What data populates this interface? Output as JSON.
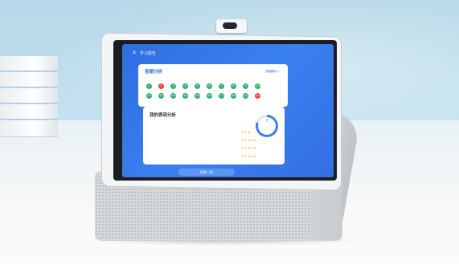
{
  "scene": {
    "accent_blue": "#3a7ff0",
    "wall_color": "#c4e2ef",
    "device_color": "#f4f5f6"
  },
  "screen": {
    "nav_title": "学习报告",
    "card1": {
      "title": "答题分析",
      "link": "查看解析 >",
      "legend": "",
      "answer_statuses": [
        "correct",
        "wrong",
        "correct",
        "correct",
        "correct",
        "correct",
        "correct",
        "correct",
        "correct",
        "correct",
        "correct",
        "correct",
        "correct",
        "correct",
        "correct",
        "correct",
        "correct",
        "correct",
        "correct",
        "wrong"
      ],
      "wrong_indices_note": ""
    },
    "card2": {
      "title": "我的表现分析",
      "score_value": "7",
      "score_sub": "",
      "rows": [
        {
          "label": "",
          "right": "",
          "rating": 3
        },
        {
          "label": "",
          "right": "",
          "rating": 5
        },
        {
          "label": "",
          "right": "",
          "rating": 5
        },
        {
          "label": "",
          "right": "",
          "rating": 5
        }
      ]
    },
    "button_label": "再来一次"
  }
}
